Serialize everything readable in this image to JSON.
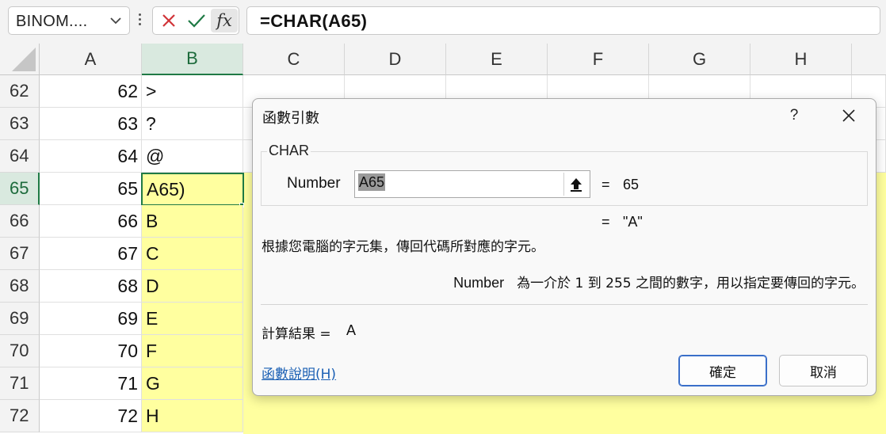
{
  "formula_bar": {
    "name_box": "BINOM....",
    "cancel_icon": "x-icon",
    "enter_icon": "check-icon",
    "insert_function_label": "fx",
    "formula": "=CHAR(A65)"
  },
  "columns": [
    "A",
    "B",
    "C",
    "D",
    "E",
    "F",
    "G",
    "H"
  ],
  "selected_column": "B",
  "rows": [
    {
      "row": "62",
      "a": "62",
      "b": ">"
    },
    {
      "row": "63",
      "a": "63",
      "b": "?"
    },
    {
      "row": "64",
      "a": "64",
      "b": "@"
    },
    {
      "row": "65",
      "a": "65",
      "b": "A65)"
    },
    {
      "row": "66",
      "a": "66",
      "b": "B"
    },
    {
      "row": "67",
      "a": "67",
      "b": "C"
    },
    {
      "row": "68",
      "a": "68",
      "b": "D"
    },
    {
      "row": "69",
      "a": "69",
      "b": "E"
    },
    {
      "row": "70",
      "a": "70",
      "b": "F"
    },
    {
      "row": "71",
      "a": "71",
      "b": "G"
    },
    {
      "row": "72",
      "a": "72",
      "b": "H"
    }
  ],
  "selected_row": "65",
  "colors": {
    "highlight": "#ffff9f",
    "accent": "#1f7a45",
    "link": "#1a5fb4"
  },
  "dialog": {
    "title": "函數引數",
    "help_label": "?",
    "close_icon": "close-icon",
    "function_name": "CHAR",
    "arg_label": "Number",
    "arg_value": "A65",
    "ref_icon": "collapse-ref-icon",
    "arg_eq": "=",
    "arg_result": "65",
    "result_eq": "=",
    "result_value": "\"A\"",
    "description": "根據您電腦的字元集，傳回代碼所對應的字元。",
    "arg_help_name": "Number",
    "arg_help_text": "為一介於 1 到 255 之間的數字，用以指定要傳回的字元。",
    "calc_label": "計算結果 =",
    "calc_value": "A",
    "help_link": "函數說明(H)",
    "ok_label": "確定",
    "cancel_label": "取消"
  }
}
